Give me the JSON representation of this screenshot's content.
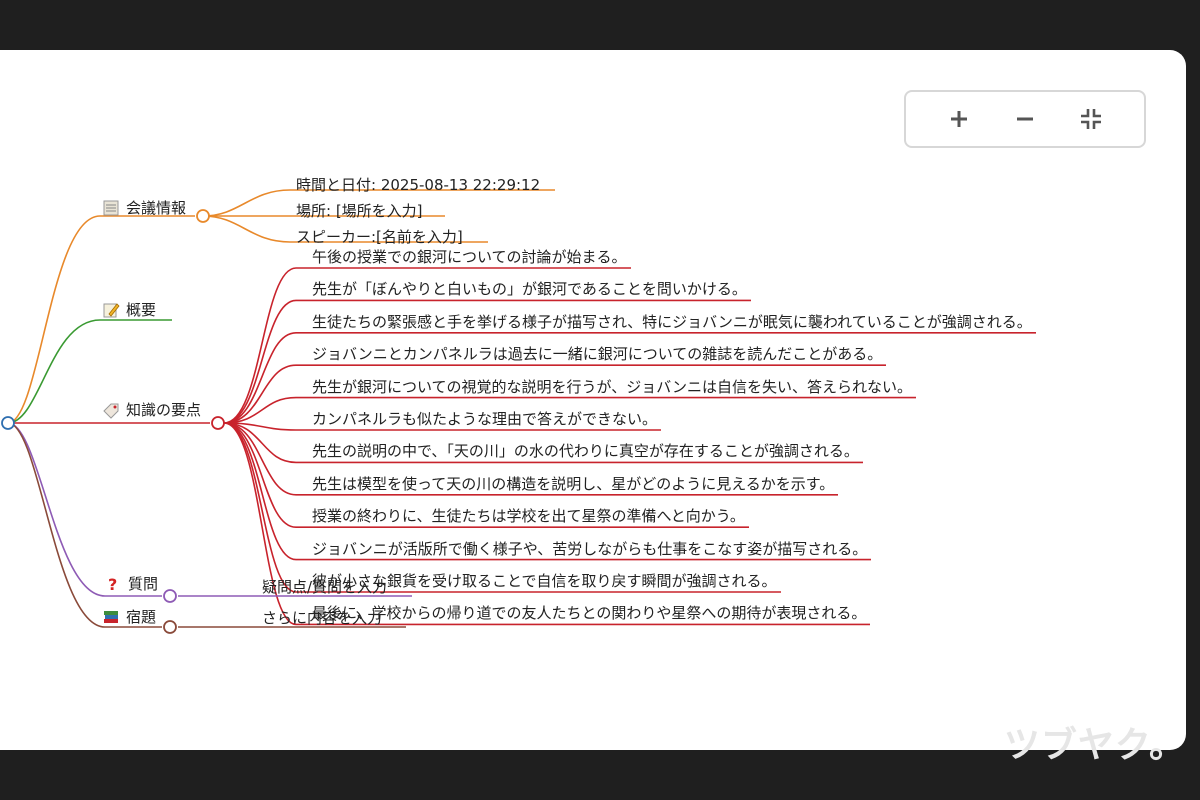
{
  "toolbar": {
    "zoom_in_icon": "plus-icon",
    "zoom_out_icon": "minus-icon",
    "fit_icon": "collapse-icon"
  },
  "mindmap": {
    "colors": {
      "info": "#e8892b",
      "summary": "#3a9a32",
      "points": "#c8232c",
      "questions": "#8e5bb5",
      "homework": "#8a4a3a",
      "root": "#2f6fb0"
    },
    "info": {
      "label": "会議情報",
      "icon": "notepad-icon",
      "children": [
        "時間と日付: 2025-08-13 22:29:12",
        "場所: [場所を入力]",
        "スピーカー:[名前を入力]"
      ]
    },
    "summary": {
      "label": "概要",
      "icon": "memo-icon"
    },
    "points": {
      "label": "知識の要点",
      "icon": "label-icon",
      "children": [
        "午後の授業での銀河についての討論が始まる。",
        "先生が「ぼんやりと白いもの」が銀河であることを問いかける。",
        "生徒たちの緊張感と手を挙げる様子が描写され、特にジョバンニが眠気に襲われていることが強調される。",
        "ジョバンニとカンパネルラは過去に一緒に銀河についての雑誌を読んだことがある。",
        "先生が銀河についての視覚的な説明を行うが、ジョバンニは自信を失い、答えられない。",
        "カンパネルラも似たような理由で答えができない。",
        "先生の説明の中で、「天の川」の水の代わりに真空が存在することが強調される。",
        "先生は模型を使って天の川の構造を説明し、星がどのように見えるかを示す。",
        "授業の終わりに、生徒たちは学校を出て星祭の準備へと向かう。",
        "ジョバンニが活版所で働く様子や、苦労しながらも仕事をこなす姿が描写される。",
        "彼が小さな銀貨を受け取ることで自信を取り戻す瞬間が強調される。",
        "最後に、学校からの帰り道での友人たちとの関わりや星祭への期待が表現される。"
      ]
    },
    "questions": {
      "label": "質問",
      "icon": "question-icon",
      "children": [
        "疑問点/質問を入力"
      ]
    },
    "homework": {
      "label": "宿題",
      "icon": "books-icon",
      "children": [
        "さらに内容を入力"
      ]
    }
  },
  "watermark": "ツブヤク。"
}
